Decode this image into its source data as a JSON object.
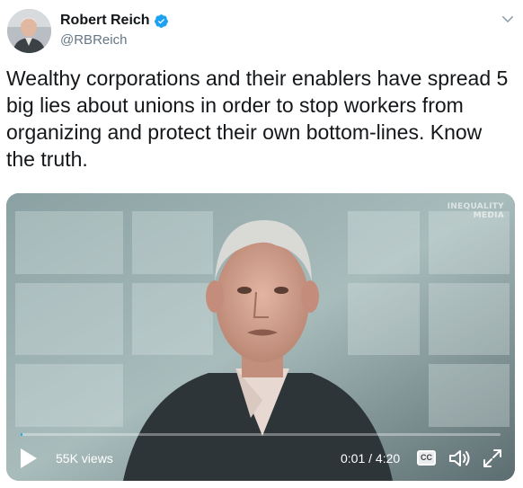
{
  "author": {
    "display_name": "Robert Reich",
    "handle": "@RBReich",
    "verified": true,
    "avatar_icon": "profile-photo"
  },
  "tweet": {
    "text": "Wealthy corporations and their enablers have spread 5 big lies about unions in order to stop workers from organizing and protect their own bottom-lines. Know the truth."
  },
  "video": {
    "watermark_line1": "INEQUALITY",
    "watermark_line2": "MEDIA",
    "views": "55K views",
    "time": "0:01 / 4:20",
    "cc_label": "CC",
    "progress": 0.004
  },
  "colors": {
    "accent": "#1da1f2",
    "text": "#14171a",
    "muted": "#657786"
  }
}
